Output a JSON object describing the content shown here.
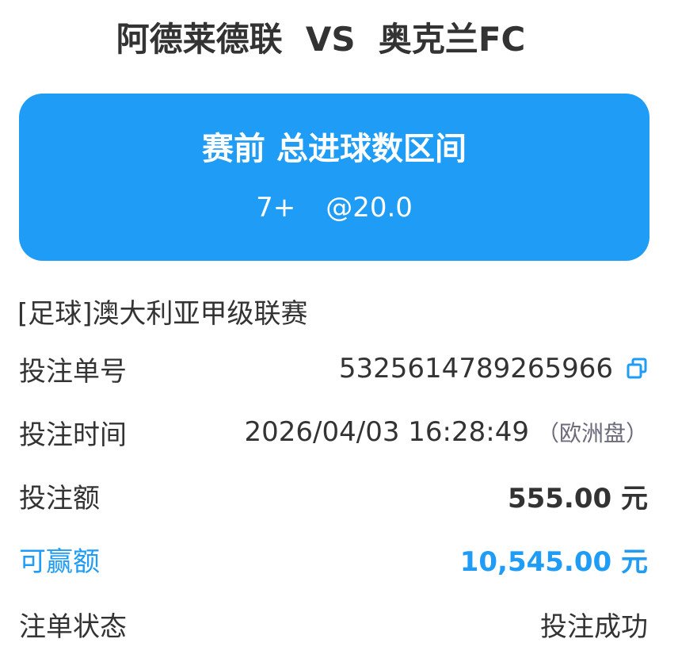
{
  "match": {
    "title": "阿德莱德联  VS  奥克兰FC"
  },
  "bet_card": {
    "title": "赛前 总进球数区间",
    "selection": "7+",
    "odds": "@20.0",
    "background_color": "#1f9cf6"
  },
  "league": "[足球]澳大利亚甲级联赛",
  "details": {
    "order_label": "投注单号",
    "order_number": "5325614789265966",
    "copy_icon": "copy-icon",
    "time_label": "投注时间",
    "time_value": "2026/04/03 16:28:49",
    "odds_type": "（欧洲盘）",
    "amount_label": "投注额",
    "amount_value": "555.00 元",
    "win_label": "可赢额",
    "win_value": "10,545.00 元",
    "status_label": "注单状态",
    "status_value": "投注成功"
  },
  "colors": {
    "accent": "#1f9cf6",
    "text": "#333333",
    "muted": "#6b6b7b"
  }
}
